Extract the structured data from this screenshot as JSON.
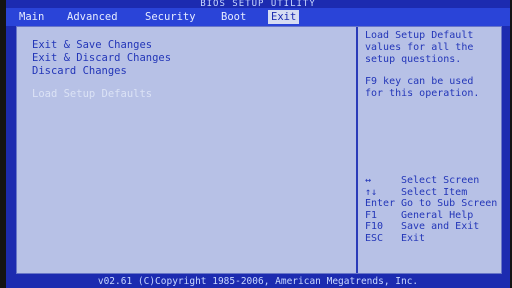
{
  "title": "BIOS SETUP UTILITY",
  "menu": [
    {
      "label": "Main"
    },
    {
      "label": "Advanced"
    },
    {
      "label": "Security"
    },
    {
      "label": "Boot"
    },
    {
      "label": "Exit"
    }
  ],
  "active_menu": "Exit",
  "options": [
    {
      "label": "Exit & Save Changes"
    },
    {
      "label": "Exit & Discard Changes"
    },
    {
      "label": "Discard Changes"
    },
    {
      "label": "Load Setup Defaults"
    }
  ],
  "help": {
    "text1": "Load Setup Default\nvalues for all the\nsetup questions.",
    "text2": "F9 key can be used\nfor this operation."
  },
  "keys": [
    {
      "key": "↔",
      "desc": "Select Screen"
    },
    {
      "key": "↑↓",
      "desc": "Select Item"
    },
    {
      "key": "Enter",
      "desc": "Go to Sub Screen"
    },
    {
      "key": "F1",
      "desc": "General Help"
    },
    {
      "key": "F10",
      "desc": "Save and Exit"
    },
    {
      "key": "ESC",
      "desc": "Exit"
    }
  ],
  "footer": "v02.61 (C)Copyright 1985-2006, American Megatrends, Inc.",
  "colors": {
    "background": "#1c2bb0",
    "panel": "#b7c1e6",
    "text": "#2336b8"
  }
}
